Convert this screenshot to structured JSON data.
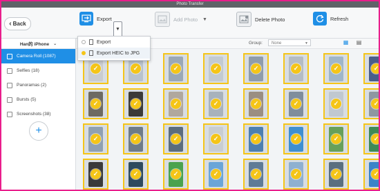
{
  "window": {
    "title": "Photo Transfer"
  },
  "toolbar": {
    "back_label": "Back",
    "export_label": "Export",
    "add_photo_label": "Add Photo",
    "delete_photo_label": "Delete Photo",
    "refresh_label": "Refresh"
  },
  "export_menu": {
    "items": [
      {
        "label": "Export",
        "selected": false
      },
      {
        "label": "Export HEIC to JPG",
        "selected": true
      }
    ]
  },
  "sidebar": {
    "device_name": "Han的 iPhone",
    "items": [
      {
        "label": "Camera Roll (1087)",
        "active": true,
        "icon": "camera-icon"
      },
      {
        "label": "Selfies (18)",
        "active": false,
        "icon": "selfie-icon"
      },
      {
        "label": "Panoramas (2)",
        "active": false,
        "icon": "panorama-icon"
      },
      {
        "label": "Bursts (5)",
        "active": false,
        "icon": "burst-icon"
      },
      {
        "label": "Screenshots (38)",
        "active": false,
        "icon": "screenshot-icon"
      }
    ],
    "add_album_icon": "plus-icon"
  },
  "main": {
    "group_label": "Group:",
    "group_value": "None"
  },
  "colors": {
    "accent": "#1f8fe6",
    "selection": "#f5c518",
    "border_highlight": "#e91e8c"
  },
  "photos": [
    {
      "color": "#c9ccd0",
      "selected": true
    },
    {
      "color": "#b8c2cc",
      "selected": true
    },
    {
      "color": "#9aa8b6",
      "selected": true
    },
    {
      "color": "#c2cad2",
      "selected": true
    },
    {
      "color": "#8f9cab",
      "selected": true
    },
    {
      "color": "#b4bcc4",
      "selected": true
    },
    {
      "color": "#9fb6c9",
      "selected": true
    },
    {
      "color": "#4a5d8a",
      "selected": true
    },
    {
      "color": "#6d6a62",
      "selected": true
    },
    {
      "color": "#3b3a38",
      "selected": true
    },
    {
      "color": "#b0a89e",
      "selected": true
    },
    {
      "color": "#a8b2bc",
      "selected": true
    },
    {
      "color": "#9a8e82",
      "selected": true
    },
    {
      "color": "#7f8d9c",
      "selected": true
    },
    {
      "color": "#c0c8d0",
      "selected": true
    },
    {
      "color": "#8e97a1",
      "selected": true
    },
    {
      "color": "#8fa0b2",
      "selected": true
    },
    {
      "color": "#6e7b88",
      "selected": true
    },
    {
      "color": "#5b6c7d",
      "selected": true
    },
    {
      "color": "#c8cdd2",
      "selected": true
    },
    {
      "color": "#4c7fb0",
      "selected": true
    },
    {
      "color": "#3e8fd0",
      "selected": true
    },
    {
      "color": "#67a05a",
      "selected": true
    },
    {
      "color": "#3f8a57",
      "selected": true
    },
    {
      "color": "#3a3a3a",
      "selected": true
    },
    {
      "color": "#2e4a5e",
      "selected": true
    },
    {
      "color": "#4aa24e",
      "selected": true
    },
    {
      "color": "#6aa5d8",
      "selected": true
    },
    {
      "color": "#5f7b96",
      "selected": true
    },
    {
      "color": "#8fb0d0",
      "selected": true
    },
    {
      "color": "#5a6f7f",
      "selected": true
    },
    {
      "color": "#3a84c8",
      "selected": true
    }
  ]
}
